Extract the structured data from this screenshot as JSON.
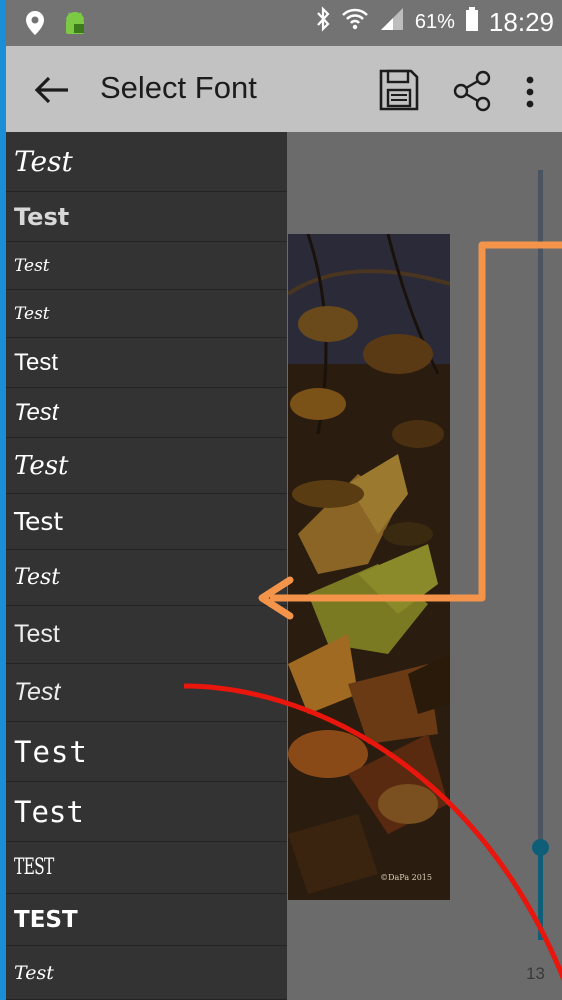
{
  "status_bar": {
    "battery": "61%",
    "time": "18:29",
    "icons": [
      "location-icon",
      "android-icon",
      "bluetooth-icon",
      "wifi-icon",
      "signal-icon",
      "battery-icon"
    ]
  },
  "app_bar": {
    "title": "Select Font",
    "icons": [
      "back-arrow-icon",
      "save-icon",
      "share-icon",
      "more-vert-icon"
    ]
  },
  "font_list": {
    "items": [
      {
        "label": "Test"
      },
      {
        "label": "Test"
      },
      {
        "label": "Test"
      },
      {
        "label": "Test"
      },
      {
        "label": "Test"
      },
      {
        "label": "Test"
      },
      {
        "label": "Test"
      },
      {
        "label": "Test"
      },
      {
        "label": "Test"
      },
      {
        "label": "Test"
      },
      {
        "label": "Test"
      },
      {
        "label": "Test"
      },
      {
        "label": "Test"
      },
      {
        "label": "TEST"
      },
      {
        "label": "TEST"
      },
      {
        "label": "Test"
      }
    ]
  },
  "preview": {
    "photo_credit": "©DaPa 2015"
  },
  "size_slider": {
    "value": "13",
    "fraction": 0.12
  },
  "colors": {
    "accent_frame": "#1a8fd6",
    "orange_arrow": "#f4944a",
    "red_arrow": "#e8160c",
    "slider": "#0e5e78"
  }
}
